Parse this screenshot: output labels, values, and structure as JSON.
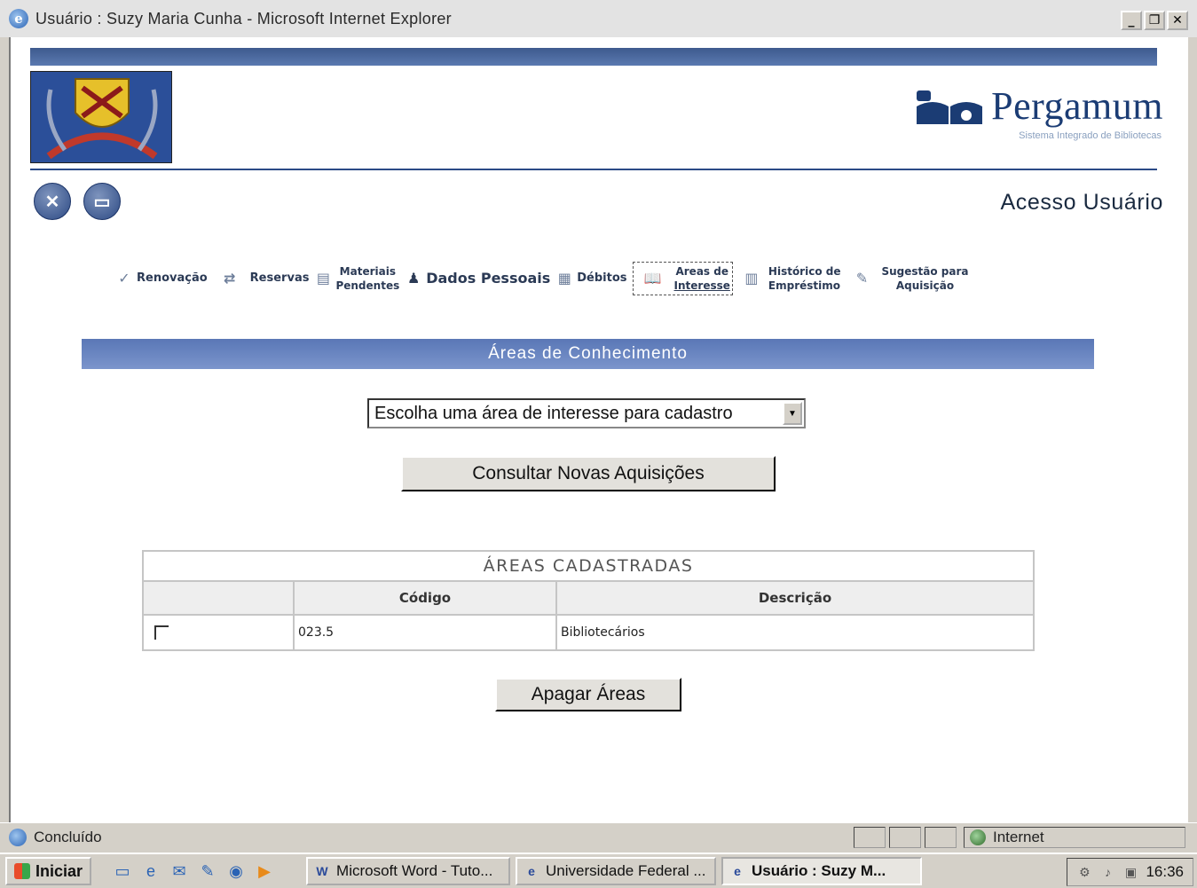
{
  "window": {
    "title": "Usuário : Suzy Maria Cunha - Microsoft Internet Explorer",
    "controls": [
      "_",
      "❐",
      "✕"
    ]
  },
  "header": {
    "brand": "Pergamum",
    "brand_sub": "Sistema Integrado de Bibliotecas",
    "access_title": "Acesso Usuário"
  },
  "nav": {
    "renovacao": "Renovação",
    "reservas": "Reservas",
    "materiais_l1": "Materiais",
    "materiais_l2": "Pendentes",
    "dados": "Dados Pessoais",
    "debitos": "Débitos",
    "areas_l1": "Areas de",
    "areas_l2": "Interesse",
    "historico_l1": "Histórico de",
    "historico_l2": "Empréstimo",
    "sugestao_l1": "Sugestão para",
    "sugestao_l2": "Aquisição"
  },
  "main": {
    "section_title": "Áreas de Conhecimento",
    "select_value": "Escolha uma área de interesse para cadastro",
    "consult_button": "Consultar Novas Aquisições",
    "table_caption": "ÁREAS CADASTRADAS",
    "col_codigo": "Código",
    "col_descricao": "Descrição",
    "rows": [
      {
        "codigo": "023.5",
        "descricao": "Bibliotecários"
      }
    ],
    "delete_button": "Apagar Áreas"
  },
  "status": {
    "text": "Concluído",
    "zone": "Internet"
  },
  "taskbar": {
    "start": "Iniciar",
    "tasks": [
      {
        "label": "Microsoft Word - Tuto..."
      },
      {
        "label": "Universidade Federal ..."
      },
      {
        "label": "Usuário : Suzy M..."
      }
    ],
    "clock": "16:36"
  }
}
